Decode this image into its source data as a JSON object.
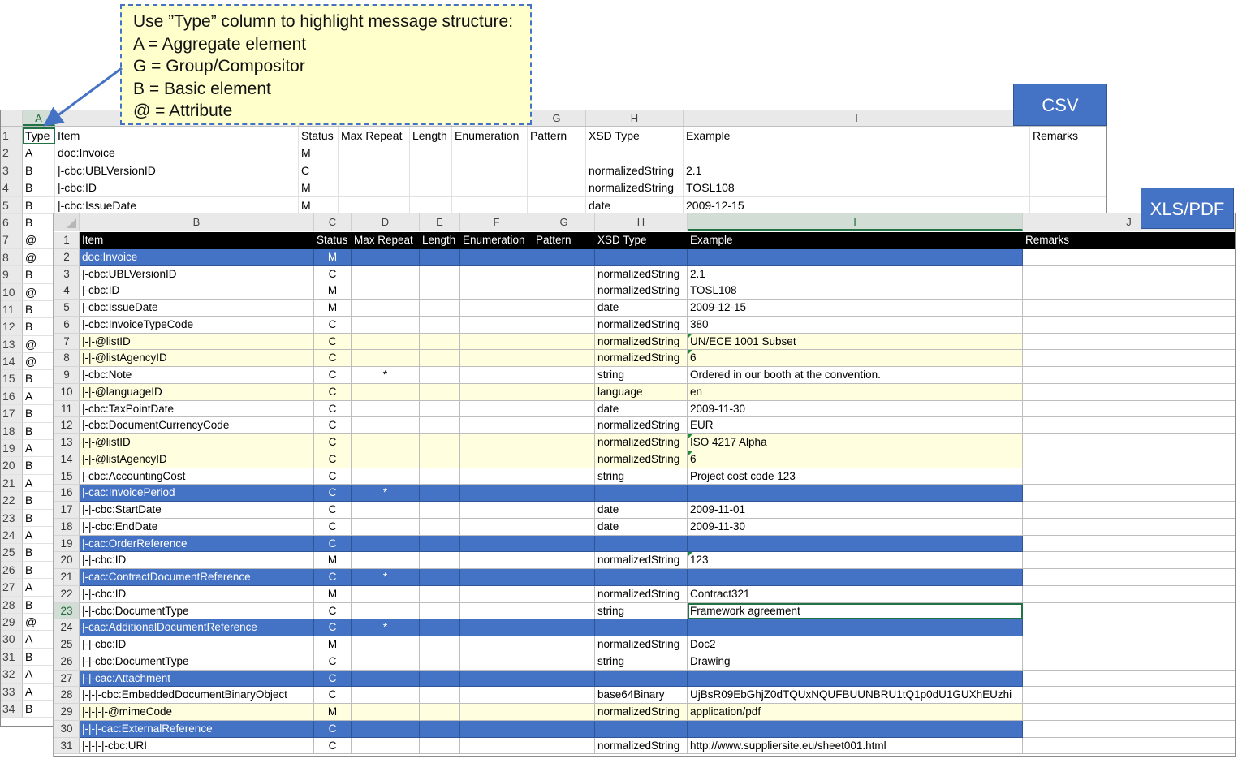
{
  "callout": {
    "lines": [
      "Use ”Type” column to highlight message structure:",
      "A = Aggregate element",
      "G = Group/Compositor",
      "B = Basic element",
      "@ = Attribute"
    ]
  },
  "labels": {
    "csv": "CSV",
    "xls": "XLS/PDF"
  },
  "csv": {
    "columns": [
      "A",
      "",
      "",
      "",
      "",
      "",
      "G",
      "H",
      "I",
      ""
    ],
    "header": [
      "Type",
      "Item",
      "Status",
      "Max Repeat",
      "Length",
      "Enumeration",
      "Pattern",
      "XSD Type",
      "Example",
      "Remarks"
    ],
    "rows": [
      [
        "A",
        "doc:Invoice",
        "M",
        "",
        "",
        "",
        "",
        "",
        "",
        ""
      ],
      [
        "B",
        "|-cbc:UBLVersionID",
        "C",
        "",
        "",
        "",
        "",
        "normalizedString",
        "2.1",
        ""
      ],
      [
        "B",
        "|-cbc:ID",
        "M",
        "",
        "",
        "",
        "",
        "normalizedString",
        "TOSL108",
        ""
      ],
      [
        "B",
        "|-cbc:IssueDate",
        "M",
        "",
        "",
        "",
        "",
        "date",
        "2009-12-15",
        ""
      ]
    ],
    "type_column_below": [
      "B",
      "@",
      "@",
      "B",
      "@",
      "B",
      "B",
      "@",
      "@",
      "B",
      "A",
      "B",
      "B",
      "A",
      "B",
      "A",
      "B",
      "B",
      "A",
      "B",
      "B",
      "A",
      "B",
      "@",
      "A",
      "B",
      "A",
      "A",
      "B"
    ],
    "row_numbers": [
      "1",
      "2",
      "3",
      "4",
      "5",
      "6",
      "7",
      "8",
      "9",
      "10",
      "11",
      "12",
      "13",
      "14",
      "15",
      "16",
      "17",
      "18",
      "19",
      "20",
      "21",
      "22",
      "23",
      "24",
      "25",
      "26",
      "27",
      "28",
      "29",
      "30",
      "31",
      "32",
      "33",
      "34"
    ]
  },
  "xls": {
    "columns": [
      "B",
      "C",
      "D",
      "E",
      "F",
      "G",
      "H",
      "I",
      "J"
    ],
    "header": [
      "Item",
      "Status",
      "Max Repeat",
      "Length",
      "Enumeration",
      "Pattern",
      "XSD Type",
      "Example",
      "Remarks"
    ],
    "rows": [
      {
        "n": "2",
        "kind": "agg",
        "item": "doc:Invoice",
        "status": "M",
        "rep": "",
        "xsd": "",
        "ex": ""
      },
      {
        "n": "3",
        "kind": "basic",
        "item": "|-cbc:UBLVersionID",
        "status": "C",
        "rep": "",
        "xsd": "normalizedString",
        "ex": "2.1"
      },
      {
        "n": "4",
        "kind": "basic",
        "item": "|-cbc:ID",
        "status": "M",
        "rep": "",
        "xsd": "normalizedString",
        "ex": "TOSL108"
      },
      {
        "n": "5",
        "kind": "basic",
        "item": "|-cbc:IssueDate",
        "status": "M",
        "rep": "",
        "xsd": "date",
        "ex": "2009-12-15"
      },
      {
        "n": "6",
        "kind": "basic",
        "item": "|-cbc:InvoiceTypeCode",
        "status": "C",
        "rep": "",
        "xsd": "normalizedString",
        "ex": "380"
      },
      {
        "n": "7",
        "kind": "att",
        "item": "|-|-@listID",
        "status": "C",
        "rep": "",
        "xsd": "normalizedString",
        "ex": "UN/ECE 1001 Subset"
      },
      {
        "n": "8",
        "kind": "att",
        "item": "|-|-@listAgencyID",
        "status": "C",
        "rep": "",
        "xsd": "normalizedString",
        "ex": "6"
      },
      {
        "n": "9",
        "kind": "basic",
        "item": "|-cbc:Note",
        "status": "C",
        "rep": "*",
        "xsd": "string",
        "ex": "Ordered in our booth at the convention."
      },
      {
        "n": "10",
        "kind": "att",
        "item": "|-|-@languageID",
        "status": "C",
        "rep": "",
        "xsd": "language",
        "ex": "en"
      },
      {
        "n": "11",
        "kind": "basic",
        "item": "|-cbc:TaxPointDate",
        "status": "C",
        "rep": "",
        "xsd": "date",
        "ex": "2009-11-30"
      },
      {
        "n": "12",
        "kind": "basic",
        "item": "|-cbc:DocumentCurrencyCode",
        "status": "C",
        "rep": "",
        "xsd": "normalizedString",
        "ex": "EUR"
      },
      {
        "n": "13",
        "kind": "att",
        "item": "|-|-@listID",
        "status": "C",
        "rep": "",
        "xsd": "normalizedString",
        "ex": "ISO 4217 Alpha"
      },
      {
        "n": "14",
        "kind": "att",
        "item": "|-|-@listAgencyID",
        "status": "C",
        "rep": "",
        "xsd": "normalizedString",
        "ex": "6"
      },
      {
        "n": "15",
        "kind": "basic",
        "item": "|-cbc:AccountingCost",
        "status": "C",
        "rep": "",
        "xsd": "string",
        "ex": "Project cost code 123"
      },
      {
        "n": "16",
        "kind": "agg",
        "item": "|-cac:InvoicePeriod",
        "status": "C",
        "rep": "*",
        "xsd": "",
        "ex": ""
      },
      {
        "n": "17",
        "kind": "basic",
        "item": "|-|-cbc:StartDate",
        "status": "C",
        "rep": "",
        "xsd": "date",
        "ex": "2009-11-01"
      },
      {
        "n": "18",
        "kind": "basic",
        "item": "|-|-cbc:EndDate",
        "status": "C",
        "rep": "",
        "xsd": "date",
        "ex": "2009-11-30"
      },
      {
        "n": "19",
        "kind": "agg",
        "item": "|-cac:OrderReference",
        "status": "C",
        "rep": "",
        "xsd": "",
        "ex": ""
      },
      {
        "n": "20",
        "kind": "basic",
        "item": "|-|-cbc:ID",
        "status": "M",
        "rep": "",
        "xsd": "normalizedString",
        "ex": "123"
      },
      {
        "n": "21",
        "kind": "agg",
        "item": "|-cac:ContractDocumentReference",
        "status": "C",
        "rep": "*",
        "xsd": "",
        "ex": ""
      },
      {
        "n": "22",
        "kind": "basic",
        "item": "|-|-cbc:ID",
        "status": "M",
        "rep": "",
        "xsd": "normalizedString",
        "ex": "Contract321"
      },
      {
        "n": "23",
        "kind": "basic",
        "item": "|-|-cbc:DocumentType",
        "status": "C",
        "rep": "",
        "xsd": "string",
        "ex": "Framework agreement"
      },
      {
        "n": "24",
        "kind": "agg",
        "item": "|-cac:AdditionalDocumentReference",
        "status": "C",
        "rep": "*",
        "xsd": "",
        "ex": ""
      },
      {
        "n": "25",
        "kind": "basic",
        "item": "|-|-cbc:ID",
        "status": "M",
        "rep": "",
        "xsd": "normalizedString",
        "ex": "Doc2"
      },
      {
        "n": "26",
        "kind": "basic",
        "item": "|-|-cbc:DocumentType",
        "status": "C",
        "rep": "",
        "xsd": "string",
        "ex": "Drawing"
      },
      {
        "n": "27",
        "kind": "agg",
        "item": "|-|-cac:Attachment",
        "status": "C",
        "rep": "",
        "xsd": "",
        "ex": ""
      },
      {
        "n": "28",
        "kind": "basic",
        "item": "|-|-|-cbc:EmbeddedDocumentBinaryObject",
        "status": "C",
        "rep": "",
        "xsd": "base64Binary",
        "ex": "UjBsR09EbGhjZ0dTQUxNQUFBUUNBRU1tQ1p0dU1GUXhEUzhi"
      },
      {
        "n": "29",
        "kind": "att",
        "item": "|-|-|-|-@mimeCode",
        "status": "M",
        "rep": "",
        "xsd": "normalizedString",
        "ex": "application/pdf"
      },
      {
        "n": "30",
        "kind": "agg",
        "item": "|-|-|-cac:ExternalReference",
        "status": "C",
        "rep": "",
        "xsd": "",
        "ex": ""
      },
      {
        "n": "31",
        "kind": "basic",
        "item": "|-|-|-|-cbc:URI",
        "status": "C",
        "rep": "",
        "xsd": "normalizedString",
        "ex": "http://www.suppliersite.eu/sheet001.html"
      }
    ]
  }
}
